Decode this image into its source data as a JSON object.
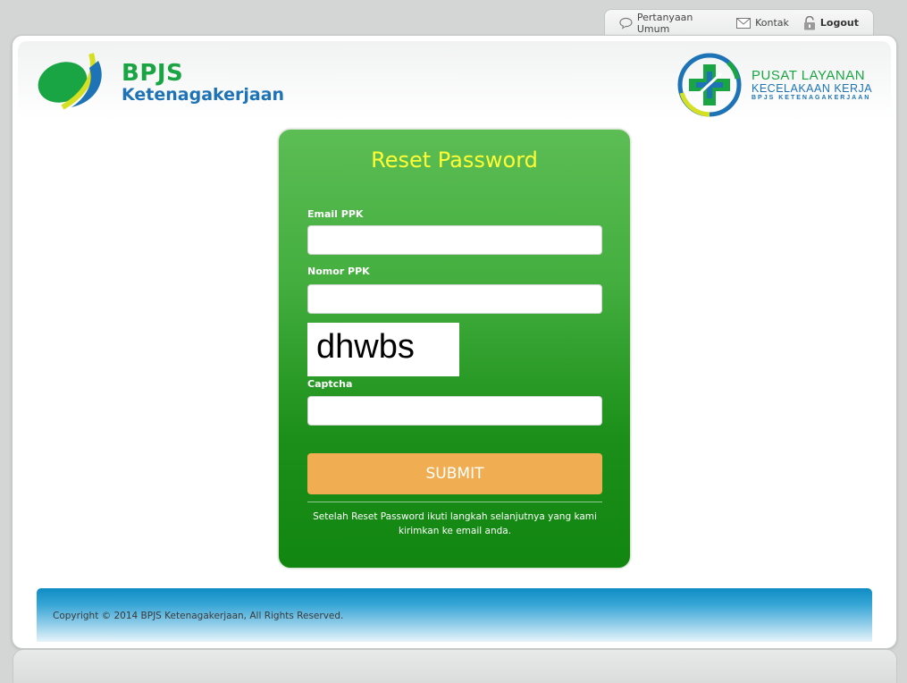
{
  "top_nav": {
    "faq_label": "Pertanyaan Umum",
    "contact_label": "Kontak",
    "logout_label": "Logout"
  },
  "brand": {
    "name": "BPJS",
    "sub": "Ketenagakerjaan"
  },
  "service_logo": {
    "line1": "PUSAT LAYANAN",
    "line2": "KECELAKAAN KERJA",
    "line3": "BPJS KETENAGAKERJAAN"
  },
  "form": {
    "title": "Reset Password",
    "email_label": "Email PPK",
    "email_value": "",
    "nomor_label": "Nomor PPK",
    "nomor_value": "",
    "captcha_image_text": "dhwbs",
    "captcha_label": "Captcha",
    "captcha_value": "",
    "submit_label": "SUBMIT",
    "note": "Setelah Reset Password ikuti langkah selanjutnya yang kami kirimkan ke email anda."
  },
  "footer": {
    "copyright": "Copyright © 2014 BPJS Ketenagakerjaan, All Rights Reserved."
  },
  "colors": {
    "brand_green": "#1aa544",
    "brand_blue": "#1d73b6",
    "title_yellow": "#ffff33",
    "submit_orange": "#f0ad52"
  }
}
